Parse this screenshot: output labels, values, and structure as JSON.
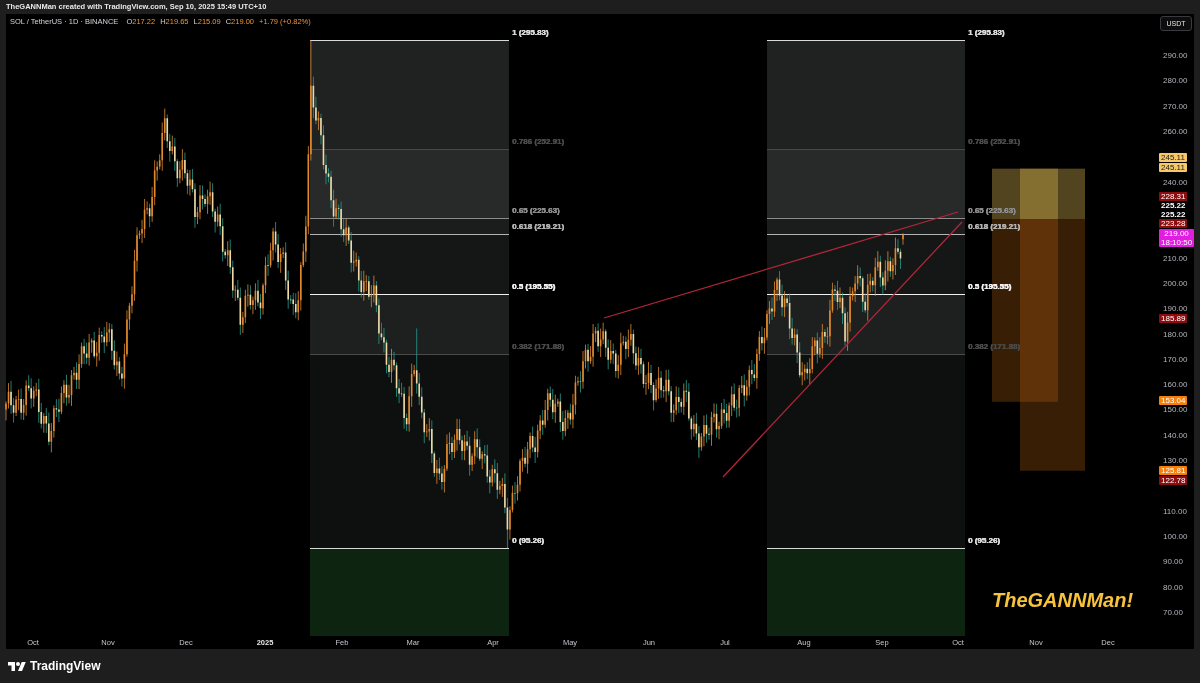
{
  "header": {
    "caption": "TheGANNMan created with TradingView.com, Sep 10, 2025 15:49 UTC+10"
  },
  "legend": {
    "symbol": "SOL / TetherUS · 1D · BINANCE",
    "ohlc": [
      {
        "key": "O",
        "value": "217.22"
      },
      {
        "key": "H",
        "value": "219.65"
      },
      {
        "key": "L",
        "value": "215.09"
      },
      {
        "key": "C",
        "value": "219.00"
      }
    ],
    "change": "+1.79 (+0.82%)"
  },
  "fib_retracements": [
    {
      "levels": [
        {
          "label": "1 (295.83)",
          "color": "#d9d9d9"
        },
        {
          "label": "0.786 (252.91)",
          "color": "#4a4a4a"
        },
        {
          "label": "0.65 (225.63)",
          "color": "#8c8c8c"
        },
        {
          "label": "0.618 (219.21)",
          "color": "#b3b3b3"
        },
        {
          "label": "0.5 (195.55)",
          "color": "#f0f0f0"
        },
        {
          "label": "0.382 (171.88)",
          "color": "#4a4a4a"
        },
        {
          "label": "0 (95.26)",
          "color": "#d9d9d9"
        }
      ]
    },
    {
      "levels": [
        {
          "label": "1 (295.83)",
          "color": "#d9d9d9"
        },
        {
          "label": "0.786 (252.91)",
          "color": "#4a4a4a"
        },
        {
          "label": "0.65 (225.63)",
          "color": "#8c8c8c"
        },
        {
          "label": "0.618 (219.21)",
          "color": "#b3b3b3"
        },
        {
          "label": "0.5 (195.55)",
          "color": "#f0f0f0"
        },
        {
          "label": "0.382 (171.88)",
          "color": "#4a4a4a"
        },
        {
          "label": "0 (95.26)",
          "color": "#d9d9d9"
        }
      ]
    }
  ],
  "annotation": {
    "text": "TheGANNMan!"
  },
  "price_axis": {
    "currency": "USDT",
    "ticks": [
      "290.00",
      "280.00",
      "270.00",
      "260.00",
      "240.00",
      "210.00",
      "200.00",
      "190.00",
      "180.00",
      "170.00",
      "160.00",
      "150.00",
      "140.00",
      "130.00",
      "110.00",
      "100.00",
      "90.00",
      "80.00",
      "70.00"
    ]
  },
  "price_tags": [
    {
      "kind": "badge",
      "text": "245.11",
      "color": "#f7c86a"
    },
    {
      "kind": "badge",
      "text": "245.11",
      "color": "#f7c86a"
    },
    {
      "kind": "badge",
      "text": "228.31",
      "color": "#8c0d10"
    },
    {
      "kind": "plain",
      "text": "225.22"
    },
    {
      "kind": "plain",
      "text": "225.22"
    },
    {
      "kind": "badge",
      "text": "223.28",
      "color": "#8c0d10"
    },
    {
      "kind": "badge",
      "text": "219.00",
      "countdown": "18:10:50",
      "color": "#e21de2"
    },
    {
      "kind": "badge",
      "text": "185.89",
      "color": "#8c0d10"
    },
    {
      "kind": "badge",
      "text": "153.04",
      "color": "#f57f0a"
    },
    {
      "kind": "badge",
      "text": "125.81",
      "color": "#f57f0a"
    },
    {
      "kind": "badge",
      "text": "122.78",
      "color": "#8c0d10"
    }
  ],
  "time_axis": {
    "ticks": [
      {
        "label": "Oct",
        "kind": "month"
      },
      {
        "label": "Nov",
        "kind": "month"
      },
      {
        "label": "Dec",
        "kind": "month"
      },
      {
        "label": "2025",
        "kind": "year"
      },
      {
        "label": "Feb",
        "kind": "month"
      },
      {
        "label": "Mar",
        "kind": "month"
      },
      {
        "label": "Apr",
        "kind": "month"
      },
      {
        "label": "May",
        "kind": "month"
      },
      {
        "label": "Jun",
        "kind": "month"
      },
      {
        "label": "Jul",
        "kind": "month"
      },
      {
        "label": "Aug",
        "kind": "month"
      },
      {
        "label": "Sep",
        "kind": "month"
      },
      {
        "label": "Oct",
        "kind": "month"
      },
      {
        "label": "Nov",
        "kind": "month"
      },
      {
        "label": "Dec",
        "kind": "month"
      }
    ]
  },
  "footer": {
    "brand": "TradingView"
  }
}
